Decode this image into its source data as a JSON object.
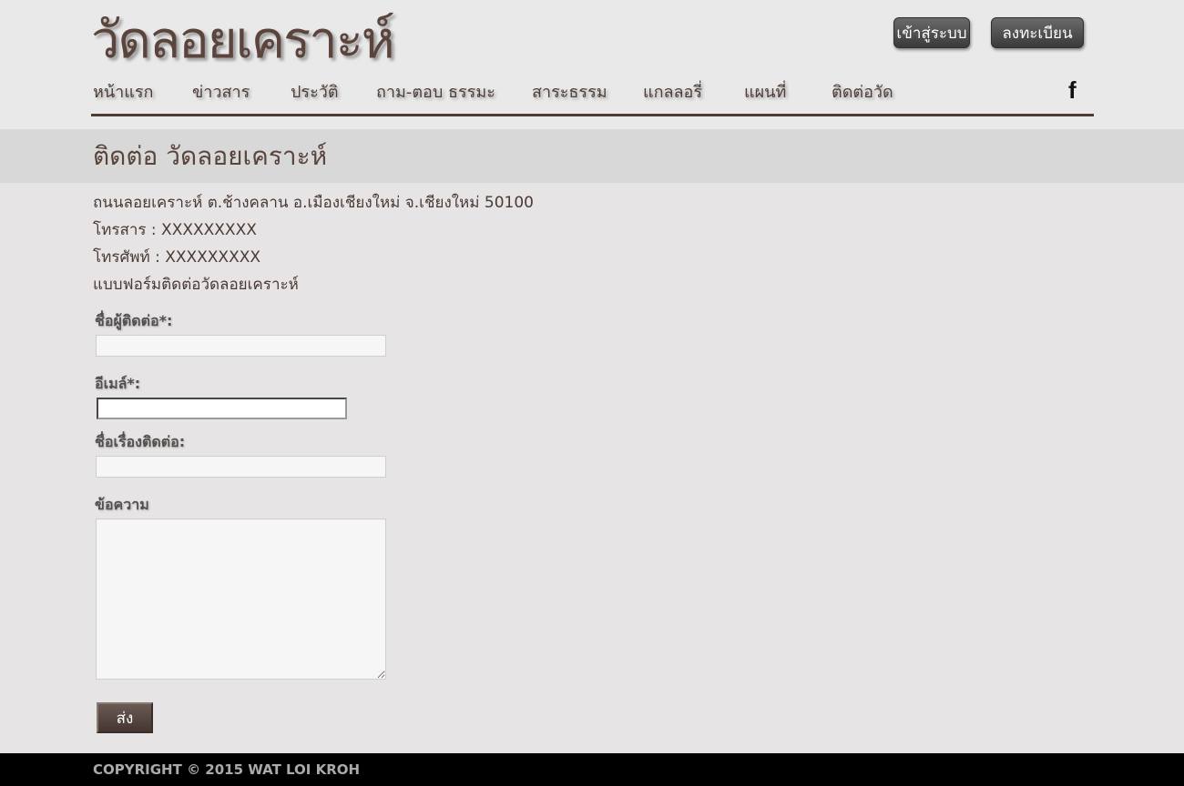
{
  "header": {
    "logo": "วัดลอยเคราะห์",
    "login_label": "เข้าสู่ระบบ",
    "register_label": "ลงทะเบียน"
  },
  "nav": {
    "items": [
      {
        "label": "หน้าแรก"
      },
      {
        "label": "ข่าวสาร"
      },
      {
        "label": "ประวัติ"
      },
      {
        "label": "ถาม-ตอบ ธรรมะ"
      },
      {
        "label": "สาระธรรม"
      },
      {
        "label": "แกลลอรี่"
      },
      {
        "label": "แผนที่"
      },
      {
        "label": "ติดต่อวัด"
      }
    ],
    "facebook_icon": "facebook-icon",
    "facebook_glyph": "f"
  },
  "page": {
    "title": "ติดต่อ วัดลอยเคราะห์"
  },
  "contact_info": {
    "address": "ถนนลอยเคราะห์ ต.ช้างคลาน อ.เมืองเชียงใหม่ จ.เชียงใหม่ 50100",
    "fax": "โทรสาร : XXXXXXXXX",
    "phone": "โทรศัพท์ : XXXXXXXXX",
    "form_heading": "แบบฟอร์มติดต่อวัดลอยเคราะห์"
  },
  "form": {
    "name_label": "ชื่อผู้ติดต่อ*:",
    "name_value": "",
    "email_label": "อีเมล์*:",
    "email_value": "",
    "subject_label": "ชื่อเรื่องติดต่อ:",
    "subject_value": "",
    "message_label": "ข้อความ",
    "message_value": "",
    "submit_label": "ส่ง"
  },
  "footer": {
    "copyright": "COPYRIGHT © 2015 WAT LOI KROH"
  }
}
